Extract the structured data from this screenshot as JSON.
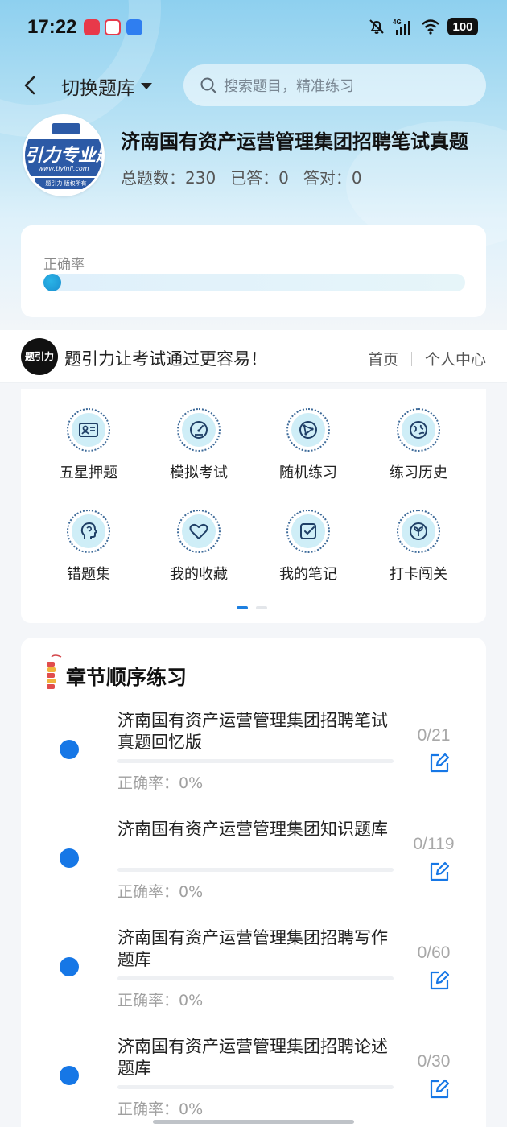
{
  "status_bar": {
    "time": "17:22",
    "network": "4G",
    "battery": "100",
    "colors": {
      "app1": "#e8394a",
      "app2": "#e8394a",
      "app3": "#2f7ef0"
    }
  },
  "nav": {
    "switch_label": "切换题库",
    "search_placeholder": "搜索题目，精准练习"
  },
  "bank": {
    "logo_text": "引力专业题",
    "logo_url": "www.tiyinli.com",
    "logo_sub": "题引力 版权所有",
    "title": "济南国有资产运营管理集团招聘笔试真题",
    "total_label": "总题数：230",
    "answered_label": "已答：0",
    "correct_label": "答对：0"
  },
  "accuracy": {
    "label": "正确率",
    "fraction": 0
  },
  "banner": {
    "logo_text": "题引力",
    "slogan": "题引力让考试通过更容易！",
    "link_home": "首页",
    "link_profile": "个人中心"
  },
  "features": [
    {
      "label": "五星押题",
      "icon": "id-card-icon"
    },
    {
      "label": "模拟考试",
      "icon": "speedometer-icon"
    },
    {
      "label": "随机练习",
      "icon": "network-icon"
    },
    {
      "label": "练习历史",
      "icon": "globe-icon"
    },
    {
      "label": "错题集",
      "icon": "head-icon"
    },
    {
      "label": "我的收藏",
      "icon": "heart-icon"
    },
    {
      "label": "我的笔记",
      "icon": "note-check-icon"
    },
    {
      "label": "打卡闯关",
      "icon": "sprout-icon"
    }
  ],
  "chapters": {
    "title": "章节顺序练习",
    "items": [
      {
        "name": "济南国有资产运营管理集团招聘笔试真题回忆版",
        "count": "0/21",
        "rate": "正确率：0%"
      },
      {
        "name": "济南国有资产运营管理集团知识题库",
        "count": "0/119",
        "rate": "正确率：0%"
      },
      {
        "name": "济南国有资产运营管理集团招聘写作题库",
        "count": "0/60",
        "rate": "正确率：0%"
      },
      {
        "name": "济南国有资产运营管理集团招聘论述题库",
        "count": "0/30",
        "rate": "正确率：0%"
      }
    ]
  },
  "theme": {
    "accent": "#1677e6",
    "icon_bg": "#cfeef7",
    "icon_stroke": "#1f3f66"
  }
}
